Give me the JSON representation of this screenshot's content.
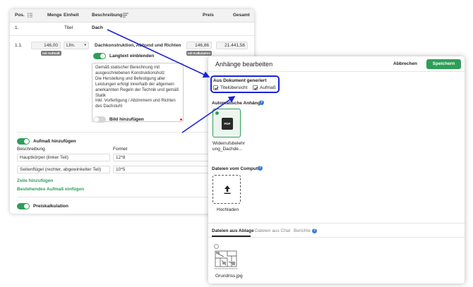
{
  "table": {
    "headers": {
      "pos": "Pos.",
      "menge": "Menge",
      "einheit": "Einheit",
      "beschreibung": "Beschreibung",
      "preis": "Preis",
      "gesamt": "Gesamt"
    },
    "title_row": {
      "pos": "1.",
      "type": "Titel",
      "name": "Dach"
    },
    "item_row": {
      "pos": "1.1.",
      "menge": "146,00",
      "menge_badge": "mit Aufmaß",
      "einheit": "Lfm.",
      "beschreibung": "Dachkonstruktion, Abbund und Richten",
      "preis": "146,86",
      "preis_badge": "mit Kalkulation",
      "gesamt": "21.441,56"
    },
    "langtext_label": "Langtext einblenden",
    "langtext_lines": [
      "Gemäß statischer Berechnung mit",
      "ausgeschriebenen Konstruktionsholz",
      "Die Herstellung und Befestigung aller",
      "Leistungen erfolgt innerhalb der allgemein",
      "anerkannten Regeln der Technik und gemäß",
      "Statik",
      "Inkl. Vorfertigung / Abzimmern und Richten",
      "des Dachstuhl"
    ],
    "bild_label": "Bild hinzufügen",
    "aufmass_label": "Aufmaß hinzufügen",
    "aufmass_cols": {
      "beschreibung": "Beschreibung",
      "formel": "Formel"
    },
    "aufmass_rows": [
      {
        "beschreibung": "Hauptkörper (linker Teil)",
        "formel": "12*8"
      },
      {
        "beschreibung": "Seitenflügel (rechter, abgewinkelter Teil)",
        "formel": "10*5"
      }
    ],
    "zeile_link": "Zeile hinzufügen",
    "bestehendes_link": "Bestehendes Aufmaß einfügen",
    "preiskalk_label": "Preiskalkulation"
  },
  "modal": {
    "title": "Anhänge bearbeiten",
    "cancel": "Abbrechen",
    "save": "Speichern",
    "generated": {
      "heading": "Aus Dokument generiert",
      "options": [
        {
          "label": "Titelübersicht",
          "checked": true
        },
        {
          "label": "Aufmaß",
          "checked": true
        }
      ]
    },
    "auto": {
      "heading": "Automatische Anhänge",
      "file_icon_text": "PDF",
      "file_name_lines": [
        "Widerrufsbelehr",
        "ung_Dachde..."
      ]
    },
    "computer": {
      "heading": "Dateien vom Computer",
      "upload_label": "Hochladen"
    },
    "tabs": [
      {
        "label": "Dateien aus Ablage",
        "active": true
      },
      {
        "label": "Dateien aus Chat",
        "active": false
      },
      {
        "label": "Berichte",
        "active": false
      }
    ],
    "ablage_file": "Grundriss.jpg"
  },
  "colors": {
    "accent": "#2e9e58",
    "highlight": "#1a22d8",
    "help": "#3b7dd8"
  }
}
